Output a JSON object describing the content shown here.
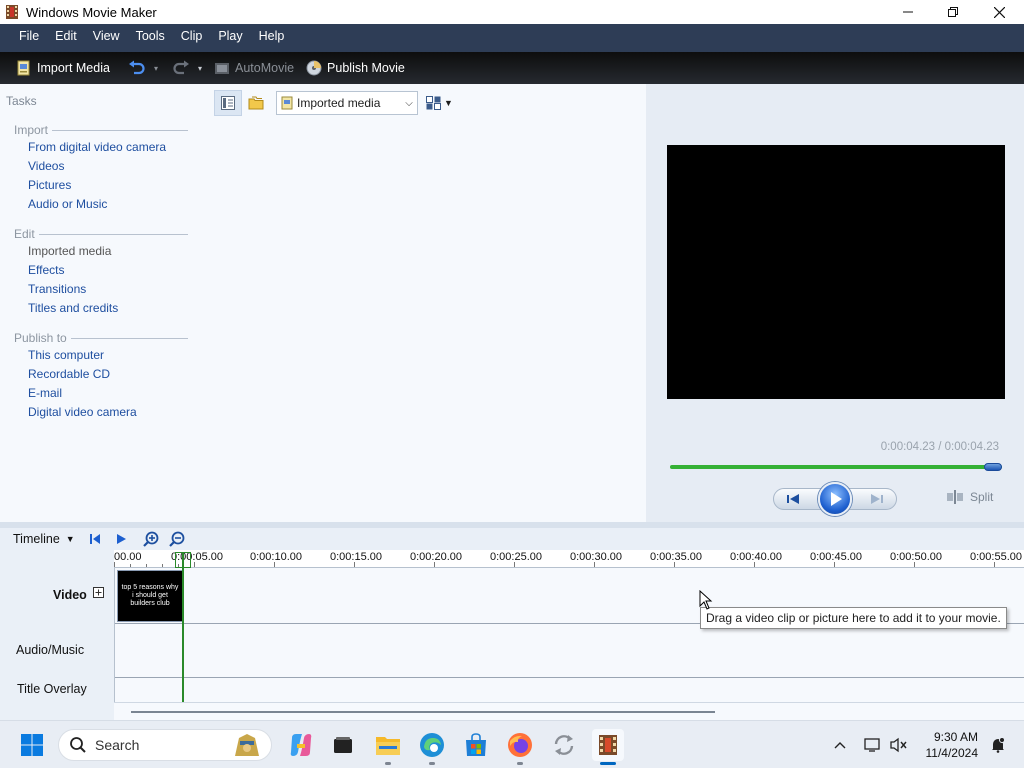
{
  "window": {
    "title": "Windows Movie Maker"
  },
  "menu": [
    "File",
    "Edit",
    "View",
    "Tools",
    "Clip",
    "Play",
    "Help"
  ],
  "toolbar": {
    "import_media": "Import Media",
    "automovie": "AutoMovie",
    "publish_movie": "Publish Movie"
  },
  "tasks": {
    "title": "Tasks",
    "sections": [
      {
        "header": "Import",
        "items": [
          "From digital video camera",
          "Videos",
          "Pictures",
          "Audio or Music"
        ]
      },
      {
        "header": "Edit",
        "items": [
          "Imported media",
          "Effects",
          "Transitions",
          "Titles and credits"
        ]
      },
      {
        "header": "Publish to",
        "items": [
          "This computer",
          "Recordable CD",
          "E-mail",
          "Digital video camera"
        ]
      }
    ]
  },
  "collection": {
    "selected": "Imported media"
  },
  "preview": {
    "time": "0:00:04.23 / 0:00:04.23",
    "progress": 1.0,
    "split_label": "Split"
  },
  "timeline": {
    "label": "Timeline",
    "ruler": [
      "00.00",
      "0:00:05.00",
      "0:00:10.00",
      "0:00:15.00",
      "0:00:20.00",
      "0:00:25.00",
      "0:00:30.00",
      "0:00:35.00",
      "0:00:40.00",
      "0:00:45.00",
      "0:00:50.00",
      "0:00:55.00"
    ],
    "tracks": {
      "video": "Video",
      "audio": "Audio/Music",
      "title_overlay": "Title Overlay"
    },
    "clip_text": "top 5 reasons why i should get builders club",
    "tooltip": "Drag a video clip or picture here to add it to your movie."
  },
  "taskbar": {
    "search_placeholder": "Search",
    "time": "9:30 AM",
    "date": "11/4/2024"
  }
}
